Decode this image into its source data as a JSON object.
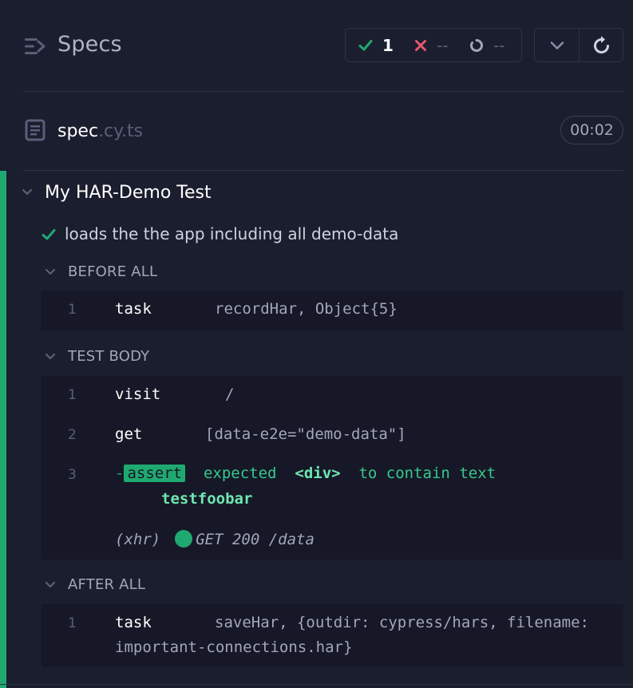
{
  "header": {
    "title": "Specs",
    "stats": {
      "passed": "1",
      "failed": "--",
      "pending": "--"
    }
  },
  "spec": {
    "name": "spec",
    "ext": ".cy.ts",
    "duration": "00:02"
  },
  "suite": {
    "title": "My HAR-Demo Test",
    "test": {
      "title": "loads the the app including all demo-data",
      "hooks": [
        {
          "title": "BEFORE ALL",
          "commands": [
            {
              "index": "1",
              "name": "task",
              "message": "recordHar, Object{5}"
            }
          ]
        },
        {
          "title": "TEST BODY",
          "commands": [
            {
              "index": "1",
              "name": "visit",
              "message": "/"
            },
            {
              "index": "2",
              "name": "get",
              "message": "[data-e2e=\"demo-data\"]"
            },
            {
              "index": "3",
              "prefix": "-",
              "name": "assert",
              "parts": [
                "expected",
                "<div>",
                "to contain text",
                "testfoobar"
              ]
            }
          ],
          "xhr": {
            "label": "(xhr)",
            "request": "GET 200 /data"
          }
        },
        {
          "title": "AFTER ALL",
          "commands": [
            {
              "index": "1",
              "name": "task",
              "message_line1": "saveHar, {outdir: cypress/hars, filename:",
              "message_line2": "important-connections.har}"
            }
          ]
        }
      ]
    }
  },
  "colors": {
    "background": "#1b1e2e",
    "command_bg": "#161827",
    "pass_green": "#1fa971",
    "fail_red": "#e45770",
    "border": "#2e3247"
  }
}
